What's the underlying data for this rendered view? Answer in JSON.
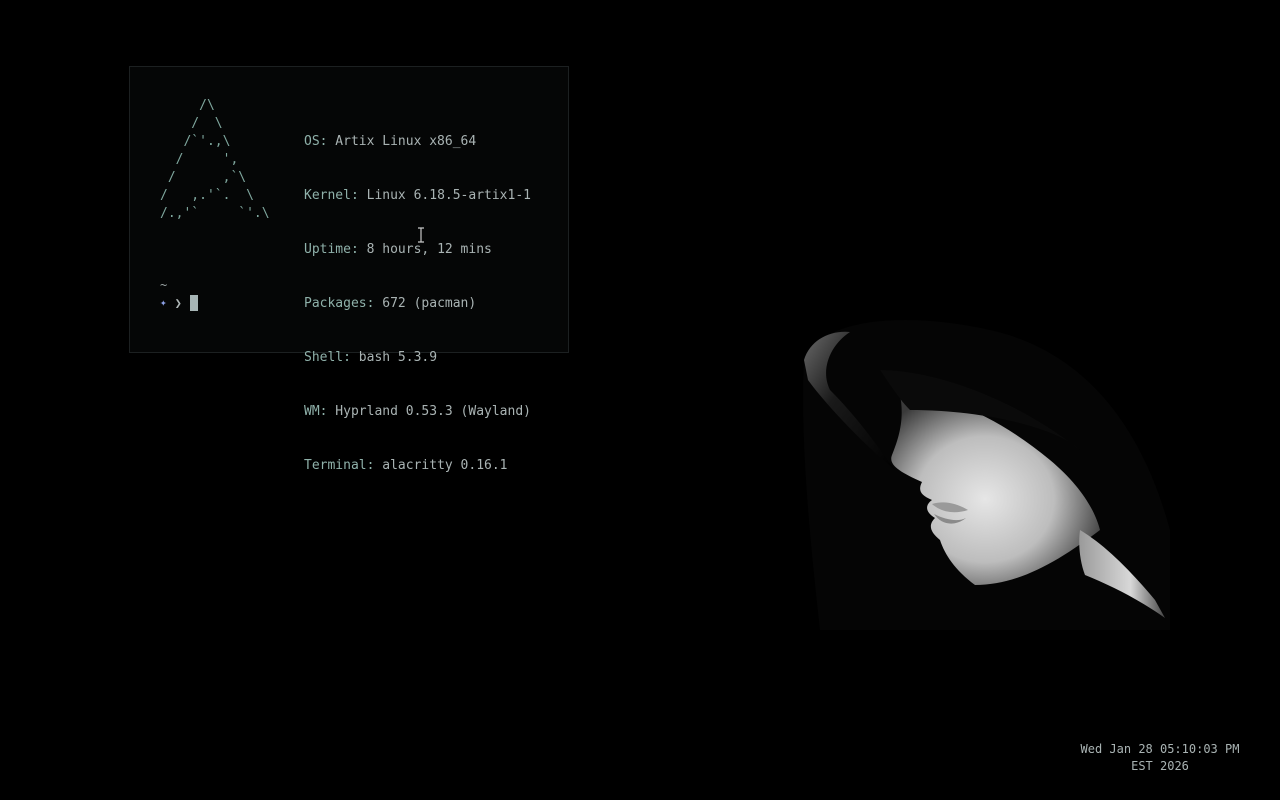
{
  "terminal": {
    "logo_art": "     /\\\n    /  \\\n   /`'.,\\\n  /     ',\n /      ,`\\\n/   ,.'`.  \\\n/.,'`     `'.\\",
    "info": [
      {
        "key": "OS:",
        "value": " Artix Linux x86_64"
      },
      {
        "key": "Kernel:",
        "value": " Linux 6.18.5-artix1-1"
      },
      {
        "key": "Uptime:",
        "value": " 8 hours, 12 mins"
      },
      {
        "key": "Packages:",
        "value": " 672 (pacman)"
      },
      {
        "key": "Shell:",
        "value": " bash 5.3.9"
      },
      {
        "key": "WM:",
        "value": " Hyprland 0.53.3 (Wayland)"
      },
      {
        "key": "Terminal:",
        "value": " alacritty 0.16.1"
      }
    ],
    "cwd": "~",
    "prompt_symbol": "✦",
    "prompt_arrow": "❯"
  },
  "clock": {
    "line1": "Wed Jan 28 05:10:03 PM",
    "line2": "EST 2026"
  },
  "colors": {
    "background": "#000000",
    "terminal_bg": "#050606",
    "logo": "#7fa79e",
    "text": "#a9b3b3",
    "prompt_star": "#8ea2e8"
  },
  "icons": {
    "mouse_cursor": "ibeam-icon",
    "prompt": "sparkle-icon"
  }
}
